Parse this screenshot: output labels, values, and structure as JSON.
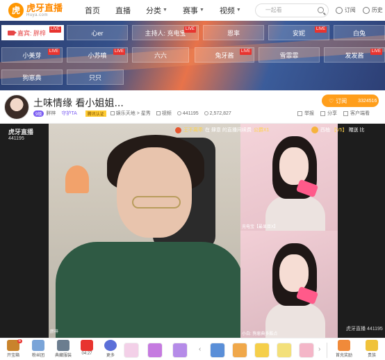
{
  "topnav": {
    "logo_cn": "虎牙直播",
    "logo_en": "Huya.com",
    "items": [
      {
        "label": "首页",
        "caret": false
      },
      {
        "label": "直播",
        "caret": false
      },
      {
        "label": "分类",
        "caret": true
      },
      {
        "label": "赛事",
        "caret": true
      },
      {
        "label": "视频",
        "caret": true
      }
    ],
    "search_placeholder": "一起看",
    "subscribe": "订阅",
    "history": "历史"
  },
  "banner": {
    "guest_label": "嘉宾: 胖梓",
    "live_tag": "LIVE",
    "chips": [
      {
        "label": "心er",
        "live": false
      },
      {
        "label": "主持人: 充电宝",
        "live": true
      },
      {
        "label": "恩率",
        "live": false
      },
      {
        "label": "安妮",
        "live": true
      },
      {
        "label": "白兔",
        "live": false
      },
      {
        "label": "小美芽",
        "live": true
      },
      {
        "label": "小苏嗔",
        "live": true
      },
      {
        "label": "六六",
        "live": false
      },
      {
        "label": "兔牙酱",
        "live": true
      },
      {
        "label": "雪霏霏",
        "live": false
      },
      {
        "label": "发发酱",
        "live": true
      },
      {
        "label": "狗崽典",
        "live": false
      },
      {
        "label": "只只",
        "live": false
      }
    ]
  },
  "room": {
    "title": "土味情缘 看小姐姐...",
    "level_badge": "9级",
    "anchor": "胖梓",
    "guard": "守护TA",
    "cert": "腾讯认证",
    "category": "娱乐天地 > 星秀",
    "video": "视频",
    "viewers": "441195",
    "fans": "2,572,827",
    "subscribe_label": "订阅",
    "subscribe_count": "3324516",
    "actions": [
      "举报",
      "分享",
      "客户端看"
    ]
  },
  "video": {
    "watermark_brand": "虎牙直播",
    "watermark_id": "441195",
    "marquee_user": "王不离乖",
    "marquee_text": "在 肆意 的直播间续费",
    "marquee_gold": "公爵X1",
    "right_user": "西柚",
    "right_level": "【V5】",
    "right_text": "赠送 比",
    "cam_top_label": "充电宝【最显目X】",
    "cam_bot_label": "小白: 狗崽典多酷点",
    "anchor_corner": "胖梓",
    "brand_corner": "虎牙直播 441195"
  },
  "toolbar": {
    "left": [
      {
        "label": "开宝箱",
        "badge": "6"
      },
      {
        "label": "粉丝团"
      },
      {
        "label": "典藏服装"
      },
      {
        "label": "04:27"
      },
      {
        "label": "更多"
      }
    ],
    "right": [
      {
        "label": "首充奖励"
      },
      {
        "label": "贵族"
      }
    ]
  },
  "colors": {
    "accent": "#ff9600",
    "live": "#e8342f",
    "subscribe": "#ff9e1b"
  }
}
